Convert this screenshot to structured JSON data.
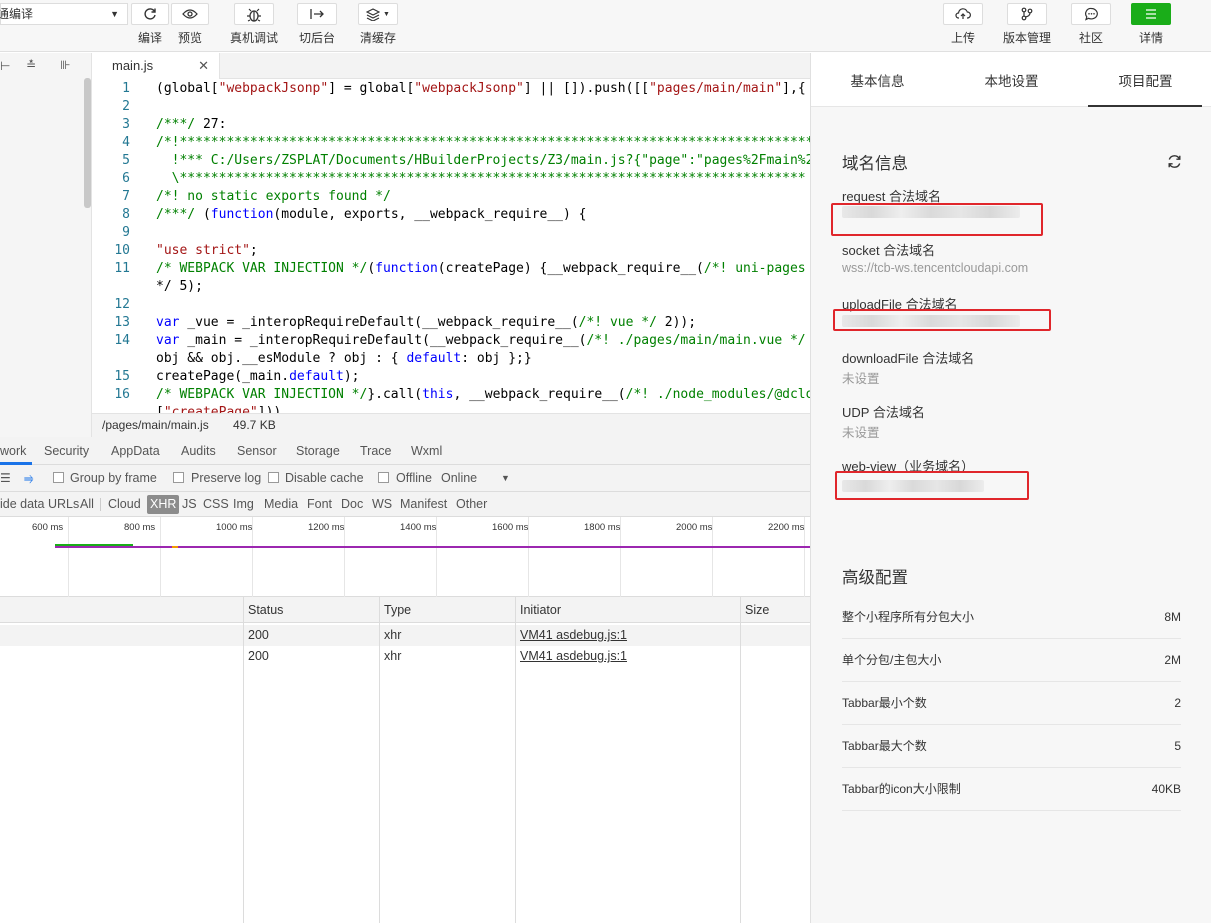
{
  "toolbar": {
    "compile_mode": "普通编译",
    "buttons": [
      {
        "icon": "refresh-icon",
        "label": "编译"
      },
      {
        "icon": "eye-icon",
        "label": "预览"
      },
      {
        "icon": "bug-icon",
        "label": "真机调试"
      },
      {
        "icon": "switch-background-icon",
        "label": "切后台"
      },
      {
        "icon": "layers-icon",
        "label": "清缓存"
      },
      {
        "icon": "cloud-upload-icon",
        "label": "上传"
      },
      {
        "icon": "version-branch-icon",
        "label": "版本管理"
      },
      {
        "icon": "chat-bubble-icon",
        "label": "社区"
      },
      {
        "icon": "menu-icon",
        "label": "详情"
      }
    ],
    "accent_color": "#1aad19"
  },
  "editor": {
    "tab_label": "main.js",
    "status_path": "/pages/main/main.js",
    "status_size": "49.7 KB",
    "line_numbers": [
      "1",
      "2",
      "3",
      "4",
      "5",
      "6",
      "7",
      "8",
      "9",
      "10",
      "11",
      "",
      "12",
      "13",
      "14",
      "",
      "15",
      "16"
    ],
    "code_lines": [
      "(global[\"webpackJsonp\"] = global[\"webpackJsonp\"] || []).push([[\"pages/main/main\"],{",
      "",
      "/***/ 27:",
      "/*!*********************************************************************************",
      "  !*** C:/Users/ZSPLAT/Documents/HBuilderProjects/Z3/main.js?{\"page\":\"pages%2Fmain%2F",
      "  \\********************************************************************************",
      "/*! no static exports found */",
      "/***/ (function(module, exports, __webpack_require__) {",
      "",
      "\"use strict\";",
      "/* WEBPACK VAR INJECTION */(function(createPage) {__webpack_require__(/*! uni-pages *",
      "*/ 5);",
      "",
      "var _vue = _interopRequireDefault(__webpack_require__(/*! vue */ 2));",
      "var _main = _interopRequireDefault(__webpack_require__(/*! ./pages/main/main.vue */ 2",
      "obj && obj.__esModule ? obj : { default: obj };}",
      "createPage(_main.default);",
      "/* WEBPACK VAR INJECTION */}.call(this, __webpack_require__(/*! ./node_modules/@dclou",
      "[\"createPage\"]))"
    ]
  },
  "devtools": {
    "tabs": [
      "work",
      "Security",
      "AppData",
      "Audits",
      "Sensor",
      "Storage",
      "Trace",
      "Wxml"
    ],
    "filter_options": [
      "Group by frame",
      "Preserve log",
      "Disable cache",
      "Offline",
      "Online"
    ],
    "filter_types": [
      "ide data URLs",
      "All",
      "Cloud",
      "XHR",
      "JS",
      "CSS",
      "Img",
      "Media",
      "Font",
      "Doc",
      "WS",
      "Manifest",
      "Other"
    ],
    "timeline_ticks": [
      "600 ms",
      "800 ms",
      "1000 ms",
      "1200 ms",
      "1400 ms",
      "1600 ms",
      "1800 ms",
      "2000 ms",
      "2200 ms"
    ],
    "columns": [
      "Status",
      "Type",
      "Initiator",
      "Size"
    ],
    "rows": [
      {
        "status": "200",
        "type": "xhr",
        "initiator": "VM41 asdebug.js:1"
      },
      {
        "status": "200",
        "type": "xhr",
        "initiator": "VM41 asdebug.js:1"
      }
    ]
  },
  "details_panel": {
    "tabs": [
      "基本信息",
      "本地设置",
      "项目配置"
    ],
    "active_tab": "项目配置",
    "domain_section_title": "域名信息",
    "domains": [
      {
        "label": "request 合法域名",
        "value": ""
      },
      {
        "label": "socket 合法域名",
        "value": "wss://tcb-ws.tencentcloudapi.com"
      },
      {
        "label": "uploadFile 合法域名",
        "value": ""
      },
      {
        "label": "downloadFile 合法域名",
        "value": "未设置"
      },
      {
        "label": "UDP 合法域名",
        "value": "未设置"
      },
      {
        "label": "web-view（业务域名）",
        "value": ""
      }
    ],
    "advanced_title": "高级配置",
    "advanced": [
      {
        "label": "整个小程序所有分包大小",
        "value": "8M"
      },
      {
        "label": "单个分包/主包大小",
        "value": "2M"
      },
      {
        "label": "Tabbar最小个数",
        "value": "2"
      },
      {
        "label": "Tabbar最大个数",
        "value": "5"
      },
      {
        "label": "Tabbar的icon大小限制",
        "value": "40KB"
      }
    ],
    "highlight_color": "#e0262b"
  }
}
